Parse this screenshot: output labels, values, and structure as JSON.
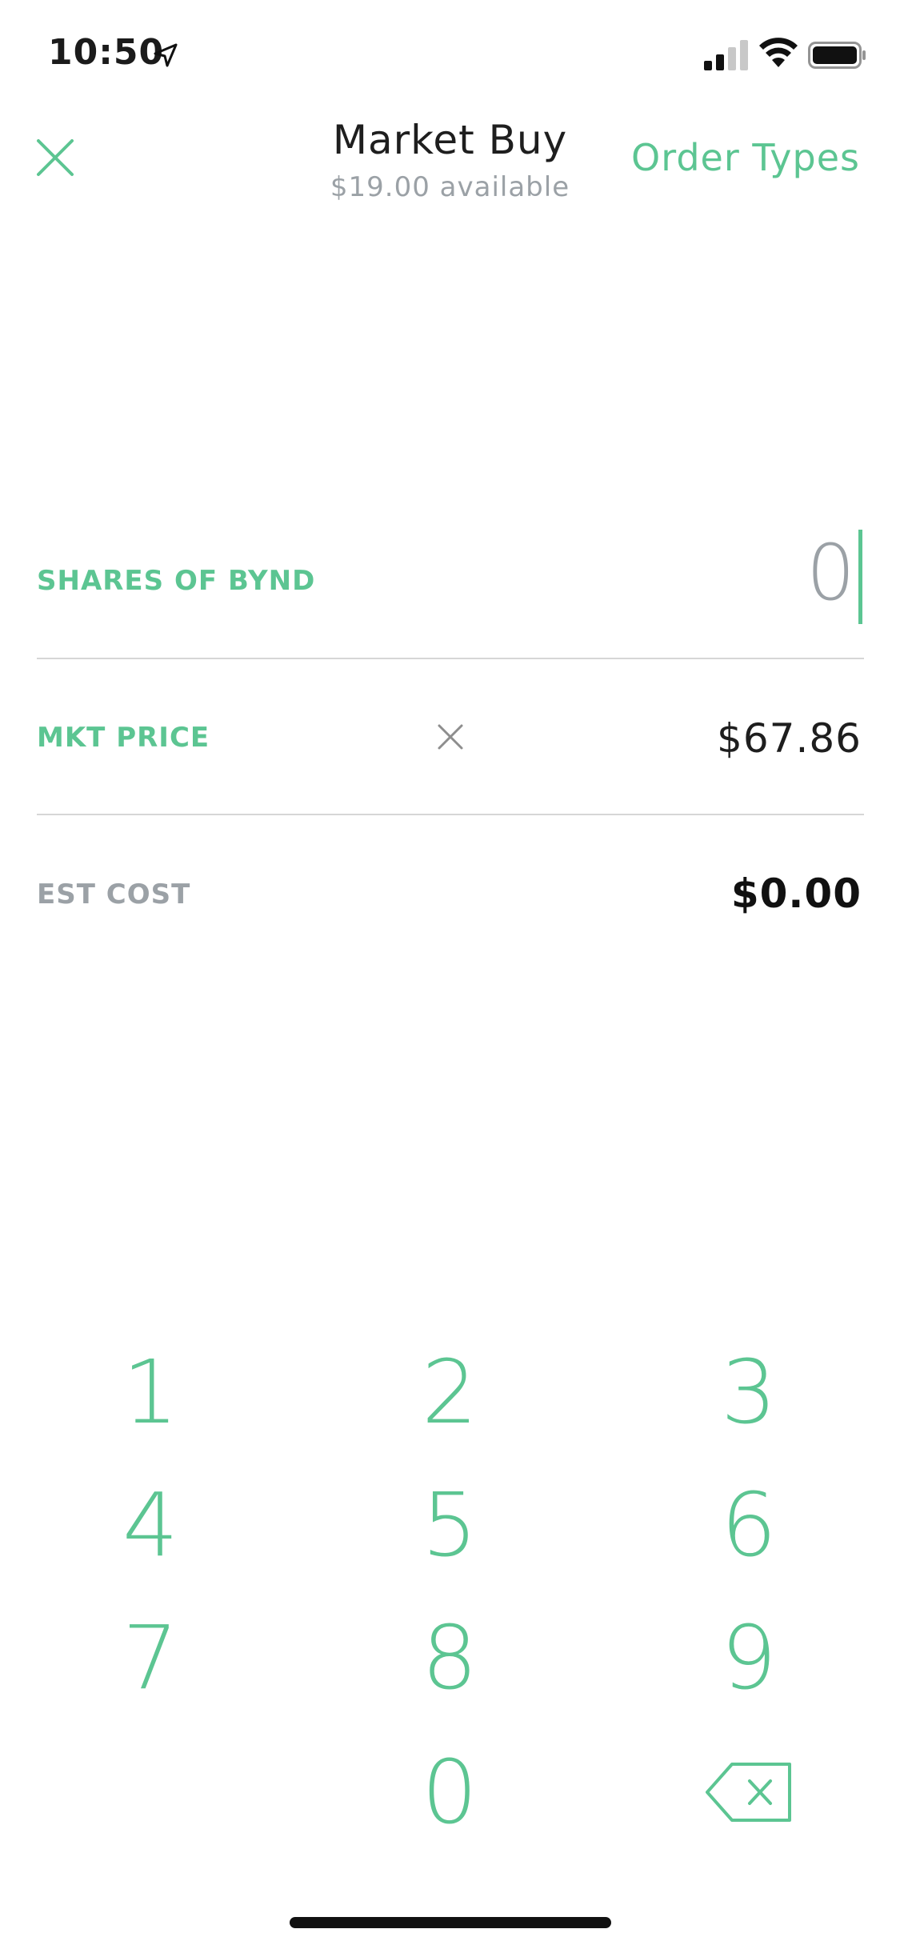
{
  "status_bar": {
    "time": "10:50"
  },
  "header": {
    "title": "Market Buy",
    "subtitle": "$19.00 available",
    "order_types_label": "Order Types"
  },
  "order_form": {
    "shares_label": "SHARES OF BYND",
    "shares_value": "0",
    "market_price_label": "MKT PRICE",
    "market_price_value": "$67.86",
    "est_cost_label": "EST COST",
    "est_cost_value": "$0.00"
  },
  "keypad": {
    "keys": [
      "1",
      "2",
      "3",
      "4",
      "5",
      "6",
      "7",
      "8",
      "9",
      "0"
    ]
  },
  "colors": {
    "accent": "#5cc592",
    "muted": "#9ba1a6",
    "divider": "#d6d6d6"
  }
}
